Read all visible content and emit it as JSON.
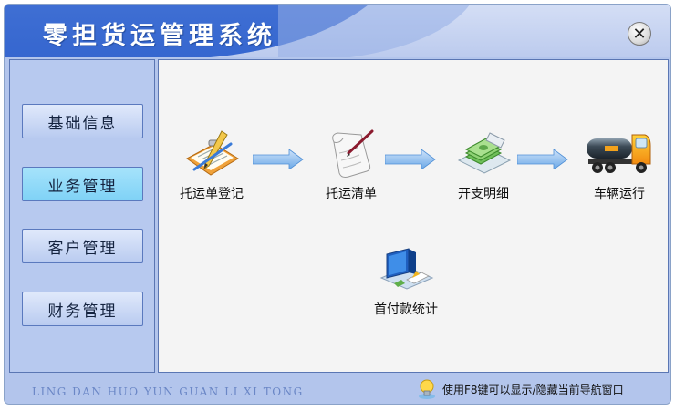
{
  "window": {
    "title": "零担货运管理系统",
    "close_glyph": "✕"
  },
  "sidebar": {
    "items": [
      {
        "label": "基础信息",
        "active": false
      },
      {
        "label": "业务管理",
        "active": true
      },
      {
        "label": "客户管理",
        "active": false
      },
      {
        "label": "财务管理",
        "active": false
      }
    ]
  },
  "workflow": {
    "tasks": [
      {
        "label": "托运单登记",
        "icon": "clipboard-pencil-icon"
      },
      {
        "label": "托运清单",
        "icon": "paper-scroll-icon"
      },
      {
        "label": "开支明细",
        "icon": "money-stack-icon"
      },
      {
        "label": "车辆运行",
        "icon": "tanker-truck-icon"
      },
      {
        "label": "首付款统计",
        "icon": "chart-monitor-icon"
      }
    ]
  },
  "statusbar": {
    "pinyin": "LING DAN HUO YUN GUAN LI XI TONG",
    "tip": "使用F8键可以显示/隐藏当前导航窗口",
    "tip_icon": "lightbulb-icon"
  },
  "colors": {
    "title_blue": "#3566cf",
    "sidebar_bg": "#b7c9ef",
    "active_button": "#7fd2f6",
    "content_bg": "#f4f4f4",
    "arrow_blue": "#6aa7e6"
  }
}
